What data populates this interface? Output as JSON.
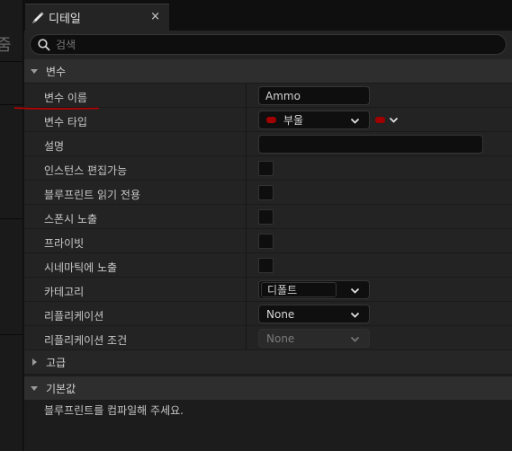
{
  "side_panel": {
    "clipped_text": "줌"
  },
  "tab": {
    "title": "디테일",
    "close_glyph": "×",
    "icon": "pencil-brush-icon"
  },
  "search": {
    "placeholder": "검색"
  },
  "sections": {
    "variables": "변수",
    "advanced": "고급",
    "default_value": "기본값"
  },
  "rows": {
    "var_name": {
      "label": "변수 이름",
      "value": "Ammo"
    },
    "var_type": {
      "label": "변수 타입",
      "value": "부울",
      "type_color": "#a00000"
    },
    "description": {
      "label": "설명",
      "value": ""
    },
    "instance_editable": {
      "label": "인스턴스 편집가능"
    },
    "blueprint_readonly": {
      "label": "블루프린트 읽기 전용"
    },
    "expose_spawn": {
      "label": "스폰시 노출"
    },
    "private": {
      "label": "프라이빗"
    },
    "expose_cinematics": {
      "label": "시네마틱에 노출"
    },
    "category": {
      "label": "카테고리",
      "value": "디폴트"
    },
    "replication": {
      "label": "리플리케이션",
      "value": "None"
    },
    "replication_condition": {
      "label": "리플리케이션 조건",
      "value": "None"
    }
  },
  "default_value_message": "블루프린트를 컴파일해 주세요.",
  "colors": {
    "panel": "#1c1c1c",
    "row": "#232323",
    "category": "#2e2e2e",
    "accent_red": "#c00000"
  }
}
